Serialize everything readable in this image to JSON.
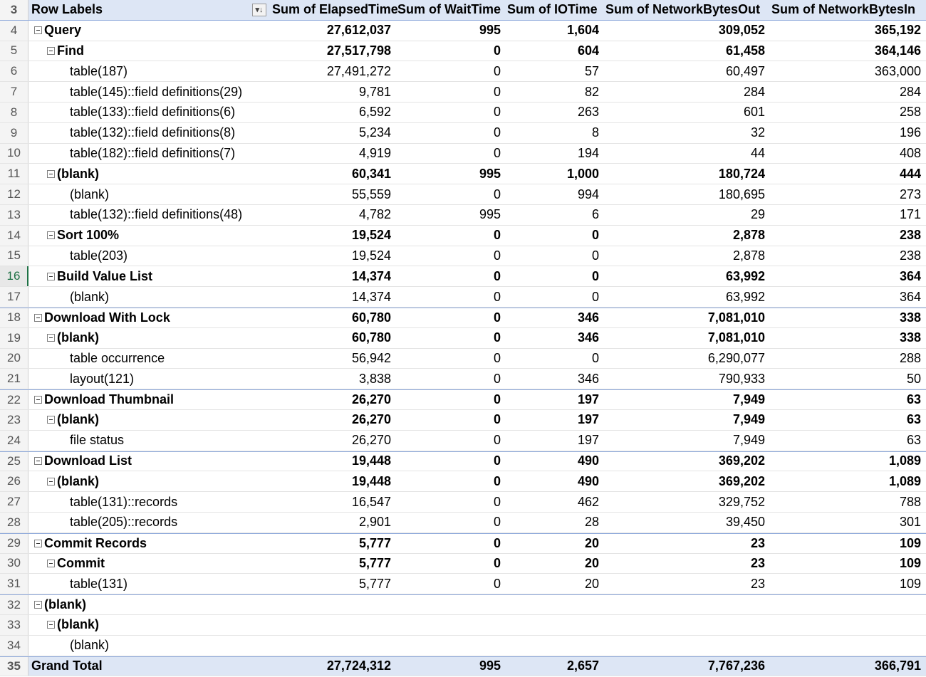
{
  "headers": {
    "row_labels": "Row Labels",
    "col1": "Sum of ElapsedTime",
    "col2": "Sum of WaitTime",
    "col3": "Sum of IOTime",
    "col4": "Sum of NetworkBytesOut",
    "col5": "Sum of NetworkBytesIn",
    "filter_icon": "sort-filter-icon"
  },
  "header_row_number": "3",
  "rows": [
    {
      "n": "4",
      "label": "Query",
      "level": 0,
      "bold": true,
      "toggle": true,
      "v": [
        "27,612,037",
        "995",
        "1,604",
        "309,052",
        "365,192"
      ]
    },
    {
      "n": "5",
      "label": "Find",
      "level": 1,
      "bold": true,
      "toggle": true,
      "v": [
        "27,517,798",
        "0",
        "604",
        "61,458",
        "364,146"
      ]
    },
    {
      "n": "6",
      "label": "table(187)",
      "level": 2,
      "bold": false,
      "toggle": false,
      "v": [
        "27,491,272",
        "0",
        "57",
        "60,497",
        "363,000"
      ]
    },
    {
      "n": "7",
      "label": "table(145)::field definitions(29)",
      "level": 2,
      "bold": false,
      "toggle": false,
      "v": [
        "9,781",
        "0",
        "82",
        "284",
        "284"
      ]
    },
    {
      "n": "8",
      "label": "table(133)::field definitions(6)",
      "level": 2,
      "bold": false,
      "toggle": false,
      "v": [
        "6,592",
        "0",
        "263",
        "601",
        "258"
      ]
    },
    {
      "n": "9",
      "label": "table(132)::field definitions(8)",
      "level": 2,
      "bold": false,
      "toggle": false,
      "v": [
        "5,234",
        "0",
        "8",
        "32",
        "196"
      ]
    },
    {
      "n": "10",
      "label": "table(182)::field definitions(7)",
      "level": 2,
      "bold": false,
      "toggle": false,
      "v": [
        "4,919",
        "0",
        "194",
        "44",
        "408"
      ]
    },
    {
      "n": "11",
      "label": "(blank)",
      "level": 1,
      "bold": true,
      "toggle": true,
      "v": [
        "60,341",
        "995",
        "1,000",
        "180,724",
        "444"
      ]
    },
    {
      "n": "12",
      "label": "(blank)",
      "level": 2,
      "bold": false,
      "toggle": false,
      "v": [
        "55,559",
        "0",
        "994",
        "180,695",
        "273"
      ]
    },
    {
      "n": "13",
      "label": "table(132)::field definitions(48)",
      "level": 2,
      "bold": false,
      "toggle": false,
      "v": [
        "4,782",
        "995",
        "6",
        "29",
        "171"
      ]
    },
    {
      "n": "14",
      "label": "Sort 100%",
      "level": 1,
      "bold": true,
      "toggle": true,
      "v": [
        "19,524",
        "0",
        "0",
        "2,878",
        "238"
      ]
    },
    {
      "n": "15",
      "label": "table(203)",
      "level": 2,
      "bold": false,
      "toggle": false,
      "v": [
        "19,524",
        "0",
        "0",
        "2,878",
        "238"
      ]
    },
    {
      "n": "16",
      "label": "Build Value List",
      "level": 1,
      "bold": true,
      "toggle": true,
      "active": true,
      "v": [
        "14,374",
        "0",
        "0",
        "63,992",
        "364"
      ]
    },
    {
      "n": "17",
      "label": "(blank)",
      "level": 2,
      "bold": false,
      "toggle": false,
      "v": [
        "14,374",
        "0",
        "0",
        "63,992",
        "364"
      ]
    },
    {
      "n": "18",
      "label": "Download With Lock",
      "level": 0,
      "bold": true,
      "toggle": true,
      "v": [
        "60,780",
        "0",
        "346",
        "7,081,010",
        "338"
      ]
    },
    {
      "n": "19",
      "label": "(blank)",
      "level": 1,
      "bold": true,
      "toggle": true,
      "v": [
        "60,780",
        "0",
        "346",
        "7,081,010",
        "338"
      ]
    },
    {
      "n": "20",
      "label": "table occurrence",
      "level": 2,
      "bold": false,
      "toggle": false,
      "v": [
        "56,942",
        "0",
        "0",
        "6,290,077",
        "288"
      ]
    },
    {
      "n": "21",
      "label": "layout(121)",
      "level": 2,
      "bold": false,
      "toggle": false,
      "v": [
        "3,838",
        "0",
        "346",
        "790,933",
        "50"
      ]
    },
    {
      "n": "22",
      "label": "Download Thumbnail",
      "level": 0,
      "bold": true,
      "toggle": true,
      "v": [
        "26,270",
        "0",
        "197",
        "7,949",
        "63"
      ]
    },
    {
      "n": "23",
      "label": "(blank)",
      "level": 1,
      "bold": true,
      "toggle": true,
      "v": [
        "26,270",
        "0",
        "197",
        "7,949",
        "63"
      ]
    },
    {
      "n": "24",
      "label": "file status",
      "level": 2,
      "bold": false,
      "toggle": false,
      "v": [
        "26,270",
        "0",
        "197",
        "7,949",
        "63"
      ]
    },
    {
      "n": "25",
      "label": "Download List",
      "level": 0,
      "bold": true,
      "toggle": true,
      "v": [
        "19,448",
        "0",
        "490",
        "369,202",
        "1,089"
      ]
    },
    {
      "n": "26",
      "label": "(blank)",
      "level": 1,
      "bold": true,
      "toggle": true,
      "v": [
        "19,448",
        "0",
        "490",
        "369,202",
        "1,089"
      ]
    },
    {
      "n": "27",
      "label": "table(131)::records",
      "level": 2,
      "bold": false,
      "toggle": false,
      "v": [
        "16,547",
        "0",
        "462",
        "329,752",
        "788"
      ]
    },
    {
      "n": "28",
      "label": "table(205)::records",
      "level": 2,
      "bold": false,
      "toggle": false,
      "v": [
        "2,901",
        "0",
        "28",
        "39,450",
        "301"
      ]
    },
    {
      "n": "29",
      "label": "Commit Records",
      "level": 0,
      "bold": true,
      "toggle": true,
      "v": [
        "5,777",
        "0",
        "20",
        "23",
        "109"
      ]
    },
    {
      "n": "30",
      "label": "Commit",
      "level": 1,
      "bold": true,
      "toggle": true,
      "v": [
        "5,777",
        "0",
        "20",
        "23",
        "109"
      ]
    },
    {
      "n": "31",
      "label": "table(131)",
      "level": 2,
      "bold": false,
      "toggle": false,
      "v": [
        "5,777",
        "0",
        "20",
        "23",
        "109"
      ]
    },
    {
      "n": "32",
      "label": "(blank)",
      "level": 0,
      "bold": true,
      "toggle": true,
      "v": [
        "",
        "",
        "",
        "",
        ""
      ]
    },
    {
      "n": "33",
      "label": "(blank)",
      "level": 1,
      "bold": true,
      "toggle": true,
      "v": [
        "",
        "",
        "",
        "",
        ""
      ]
    },
    {
      "n": "34",
      "label": "(blank)",
      "level": 2,
      "bold": false,
      "toggle": false,
      "v": [
        "",
        "",
        "",
        "",
        ""
      ]
    }
  ],
  "grand_total": {
    "n": "35",
    "label": "Grand Total",
    "v": [
      "27,724,312",
      "995",
      "2,657",
      "7,767,236",
      "366,791"
    ]
  },
  "colors": {
    "header_bg": "#dde6f5",
    "active_row_number": "#1e7145",
    "border_accent": "#8ea9db"
  }
}
